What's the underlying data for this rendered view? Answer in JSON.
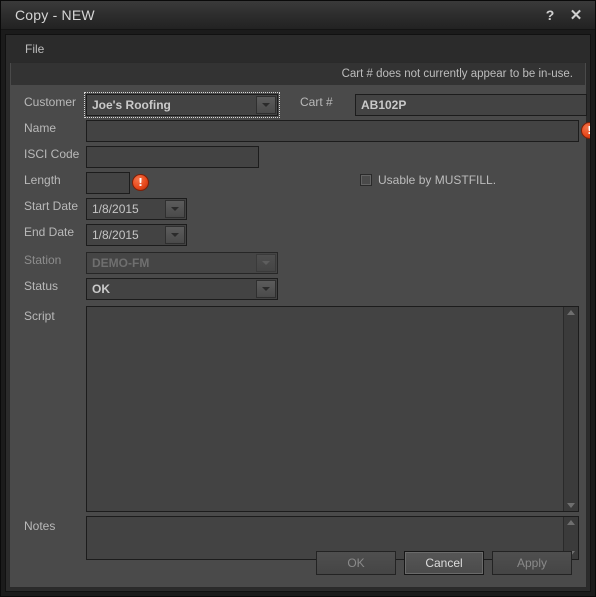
{
  "window": {
    "title": "Copy - NEW",
    "help_icon": "?",
    "close_icon": "✕"
  },
  "menubar": {
    "items": [
      {
        "label": "File"
      }
    ]
  },
  "notice": {
    "message": "Cart # does not currently appear to be in-use."
  },
  "form": {
    "customer": {
      "label": "Customer",
      "value": "Joe's Roofing",
      "focused": true
    },
    "cart": {
      "label": "Cart #",
      "value": "AB102P"
    },
    "name": {
      "label": "Name",
      "value": "",
      "error": "!"
    },
    "isci": {
      "label": "ISCI Code",
      "value": ""
    },
    "length": {
      "label": "Length",
      "value": "",
      "error": "!"
    },
    "mustfill": {
      "label": "Usable by MUSTFILL.",
      "checked": false
    },
    "start_date": {
      "label": "Start Date",
      "value": "1/8/2015"
    },
    "end_date": {
      "label": "End Date",
      "value": "1/8/2015"
    },
    "station": {
      "label": "Station",
      "value": "DEMO-FM",
      "disabled": true
    },
    "status": {
      "label": "Status",
      "value": "OK"
    },
    "script": {
      "label": "Script",
      "value": ""
    },
    "notes": {
      "label": "Notes",
      "value": ""
    }
  },
  "buttons": {
    "ok": "OK",
    "cancel": "Cancel",
    "apply": "Apply"
  },
  "colors": {
    "panel": "#4a4a4a",
    "chrome": "#2b2b2b",
    "field": "#434343",
    "error": "#e8491c",
    "text": "#c8c8c8"
  }
}
